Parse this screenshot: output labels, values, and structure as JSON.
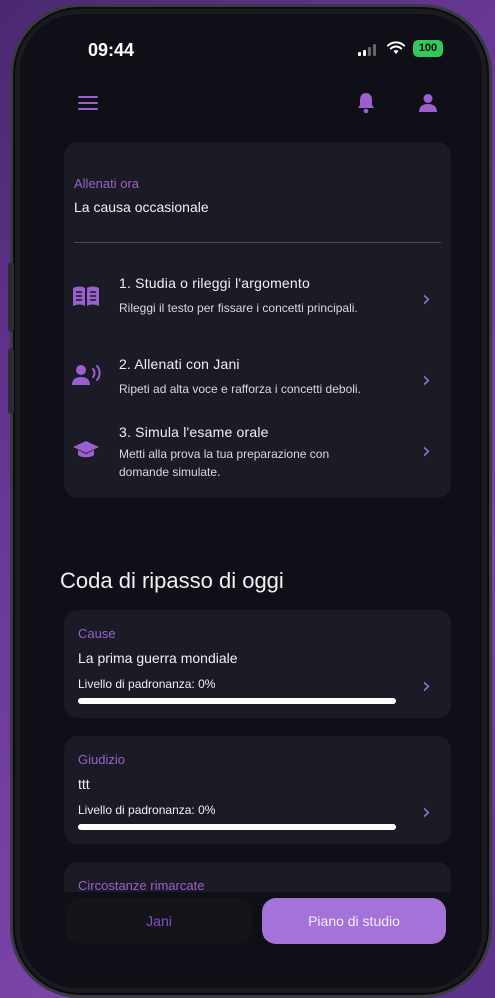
{
  "status_bar": {
    "time": "09:44",
    "battery": "100"
  },
  "practice_card": {
    "label": "Allenati ora",
    "topic": "La causa occasionale",
    "steps": [
      {
        "title": "1. Studia o rileggi l'argomento",
        "desc": "Rileggi il testo per fissare i concetti principali.",
        "icon": "book-open-icon"
      },
      {
        "title": "2. Allenati con Jani",
        "desc": "Ripeti ad alta voce e rafforza i concetti deboli.",
        "icon": "speaking-person-icon"
      },
      {
        "title": "3. Simula l'esame orale",
        "desc_line1": "Metti alla prova la tua preparazione con",
        "desc_line2": "domande simulate.",
        "icon": "graduation-cap-icon"
      }
    ]
  },
  "review_queue": {
    "title": "Coda di ripasso di oggi",
    "items": [
      {
        "category": "Cause",
        "topic": "La prima guerra mondiale",
        "mastery_label": "Livello di padronanza: 0%",
        "mastery_pct": 0
      },
      {
        "category": "Giudizio",
        "topic": "ttt",
        "mastery_label": "Livello di padronanza: 0%",
        "mastery_pct": 0
      },
      {
        "category": "Circostanze rimarcate"
      }
    ]
  },
  "bottom_nav": {
    "jani_label": "Jani",
    "plan_label": "Piano di studio"
  },
  "colors": {
    "accent": "#a472d8",
    "label_purple": "#9b5fd0",
    "card_bg": "#1a1b24",
    "screen_bg": "#0f1017"
  }
}
